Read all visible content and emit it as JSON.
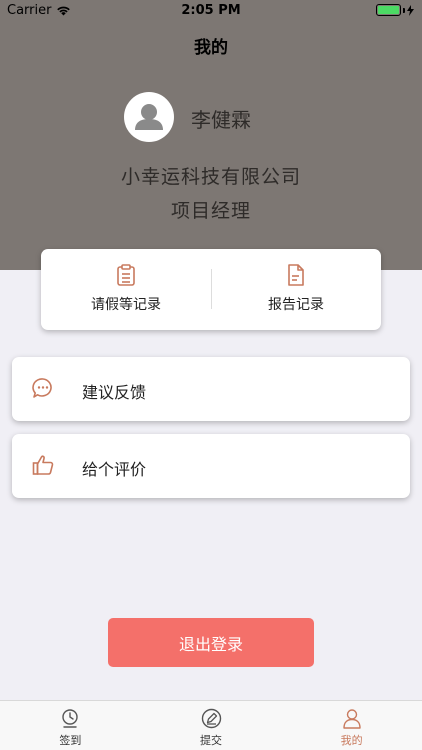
{
  "status_bar": {
    "carrier": "Carrier",
    "time": "2:05 PM"
  },
  "nav": {
    "title": "我的"
  },
  "profile": {
    "name": "李健霖",
    "company": "小幸运科技有限公司",
    "position": "项目经理"
  },
  "quick_actions": [
    {
      "label": "请假等记录",
      "icon": "clipboard-icon"
    },
    {
      "label": "报告记录",
      "icon": "document-icon"
    }
  ],
  "menu": [
    {
      "label": "建议反馈",
      "icon": "chat-bubble-icon"
    },
    {
      "label": "给个评价",
      "icon": "thumbs-up-icon"
    }
  ],
  "logout": {
    "label": "退出登录"
  },
  "tabs": [
    {
      "label": "签到",
      "icon": "clock-pin-icon",
      "active": false
    },
    {
      "label": "提交",
      "icon": "pen-circle-icon",
      "active": false
    },
    {
      "label": "我的",
      "icon": "person-icon",
      "active": true
    }
  ],
  "colors": {
    "header_bg": "#7d7773",
    "accent": "#c87a5e",
    "logout_bg": "#f4706a",
    "page_bg": "#f0eff5"
  }
}
